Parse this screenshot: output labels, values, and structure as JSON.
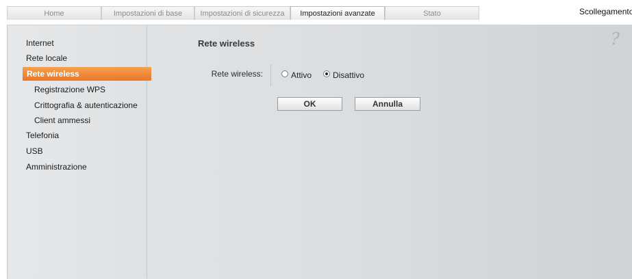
{
  "tabs": [
    {
      "label": "Home"
    },
    {
      "label": "Impostazioni di base"
    },
    {
      "label": "Impostazioni di sicurezza"
    },
    {
      "label": "Impostazioni avanzate"
    },
    {
      "label": "Stato"
    }
  ],
  "active_tab": "Impostazioni avanzate",
  "logout_label": "Scollegamento",
  "help_icon": "?",
  "sidebar": {
    "items": [
      {
        "label": "Internet"
      },
      {
        "label": "Rete locale"
      },
      {
        "label": "Rete wireless"
      },
      {
        "label": "Registrazione WPS"
      },
      {
        "label": "Crittografia & autenticazione"
      },
      {
        "label": "Client ammessi"
      },
      {
        "label": "Telefonia"
      },
      {
        "label": "USB"
      },
      {
        "label": "Amministrazione"
      }
    ],
    "active_item": "Rete wireless"
  },
  "main": {
    "title": "Rete wireless",
    "field_label": "Rete wireless:",
    "options": [
      {
        "label": "Attivo",
        "checked": false
      },
      {
        "label": "Disattivo",
        "checked": true
      }
    ],
    "ok_label": "OK",
    "cancel_label": "Annulla"
  },
  "colors": {
    "accent": "#f08a3c",
    "background": "#dcdfe1"
  }
}
